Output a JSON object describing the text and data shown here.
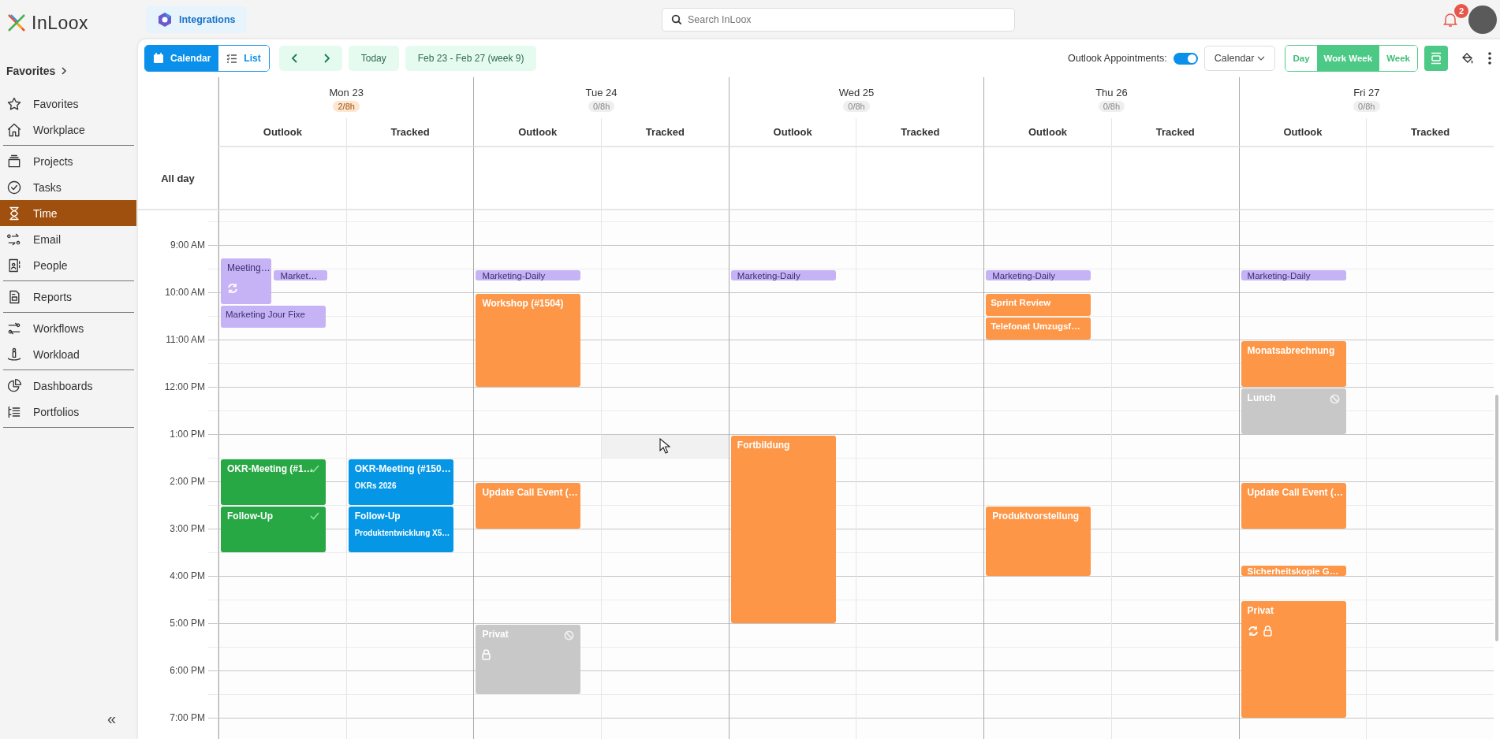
{
  "logo": {
    "text": "InLoox"
  },
  "integrations": {
    "label": "Integrations"
  },
  "search": {
    "placeholder": "Search InLoox"
  },
  "notifications": {
    "count": "2"
  },
  "sidebar": {
    "favorites_header": "Favorites",
    "groups": [
      {
        "items": [
          {
            "label": "Favorites",
            "selected": false
          },
          {
            "label": "Workplace",
            "selected": false
          }
        ]
      },
      {
        "items": [
          {
            "label": "Projects",
            "selected": false
          },
          {
            "label": "Tasks",
            "selected": false
          },
          {
            "label": "Time",
            "selected": true
          },
          {
            "label": "Email",
            "selected": false
          },
          {
            "label": "People",
            "selected": false
          }
        ]
      },
      {
        "items": [
          {
            "label": "Reports",
            "selected": false
          }
        ]
      },
      {
        "items": [
          {
            "label": "Workflows",
            "selected": false
          },
          {
            "label": "Workload",
            "selected": false
          }
        ]
      },
      {
        "items": [
          {
            "label": "Dashboards",
            "selected": false
          },
          {
            "label": "Portfolios",
            "selected": false
          }
        ]
      }
    ],
    "collapse": "«"
  },
  "toolbar": {
    "views": [
      {
        "label": "Calendar",
        "selected": true
      },
      {
        "label": "List",
        "selected": false
      }
    ],
    "today": "Today",
    "range": "Feb 23 - Feb 27 (week 9)",
    "outlook_label": "Outlook Appointments:",
    "outlook_on": true,
    "calendar_select": "Calendar",
    "spans": [
      {
        "label": "Day",
        "selected": false
      },
      {
        "label": "Work Week",
        "selected": true
      },
      {
        "label": "Week",
        "selected": false
      }
    ]
  },
  "all_day_label": "All day",
  "time_labels": [
    "9:00 AM",
    "10:00 AM",
    "11:00 AM",
    "12:00 PM",
    "1:00 PM",
    "2:00 PM",
    "3:00 PM",
    "4:00 PM",
    "5:00 PM",
    "6:00 PM",
    "7:00 PM"
  ],
  "days": [
    {
      "name": "Mon 23",
      "hours": {
        "text": "2/8h",
        "logged": true
      },
      "columns": [
        {
          "label": "Outlook",
          "events": [
            {
              "title": "Meeting…",
              "color": "#c6b3f6",
              "recurring": true,
              "private": false,
              "done": false,
              "declined": false
            },
            {
              "title": "Market…",
              "color": "#c6b3f6",
              "recurring": false,
              "private": false,
              "done": false,
              "declined": false
            },
            {
              "title": "Marketing Jour Fixe",
              "color": "#c6b3f6",
              "recurring": false,
              "private": false,
              "done": false,
              "declined": false
            },
            {
              "title": "OKR-Meeting (#1…",
              "color": "#28a745",
              "recurring": false,
              "private": false,
              "done": true,
              "declined": false
            },
            {
              "title": "Follow-Up",
              "color": "#28a745",
              "recurring": false,
              "private": false,
              "done": true,
              "declined": false
            }
          ]
        },
        {
          "label": "Tracked",
          "events": [
            {
              "title": "OKR-Meeting (#150…",
              "subtitle": "OKRs 2026",
              "color": "#0596e6",
              "recurring": false,
              "private": false,
              "done": false,
              "declined": false
            },
            {
              "title": "Follow-Up",
              "subtitle": "Produktentwicklung X5…",
              "color": "#0596e6",
              "recurring": false,
              "private": false,
              "done": false,
              "declined": false
            }
          ]
        }
      ]
    },
    {
      "name": "Tue 24",
      "hours": {
        "text": "0/8h",
        "logged": false
      },
      "columns": [
        {
          "label": "Outlook",
          "events": [
            {
              "title": "Marketing-Daily",
              "color": "#c6b3f6",
              "recurring": false,
              "private": false,
              "done": false,
              "declined": false
            },
            {
              "title": "Workshop (#1504)",
              "color": "#fd9647",
              "recurring": false,
              "private": false,
              "done": false,
              "declined": false
            },
            {
              "title": "Update Call Event (…",
              "color": "#fd9647",
              "recurring": false,
              "private": false,
              "done": false,
              "declined": false
            },
            {
              "title": "Privat",
              "color": "#c8c8c8",
              "recurring": false,
              "private": true,
              "done": false,
              "declined": true
            }
          ]
        },
        {
          "label": "Tracked",
          "hovered": true
        }
      ]
    },
    {
      "name": "Wed 25",
      "hours": {
        "text": "0/8h",
        "logged": false
      },
      "columns": [
        {
          "label": "Outlook",
          "events": [
            {
              "title": "Marketing-Daily",
              "color": "#c6b3f6",
              "recurring": false,
              "private": false,
              "done": false,
              "declined": false
            },
            {
              "title": "Fortbildung",
              "color": "#fd9647",
              "recurring": false,
              "private": false,
              "done": false,
              "declined": false
            }
          ]
        },
        {
          "label": "Tracked"
        }
      ]
    },
    {
      "name": "Thu 26",
      "hours": {
        "text": "0/8h",
        "logged": false
      },
      "columns": [
        {
          "label": "Outlook",
          "events": [
            {
              "title": "Marketing-Daily",
              "color": "#c6b3f6",
              "recurring": false,
              "private": false,
              "done": false,
              "declined": false
            },
            {
              "title": "Sprint Review",
              "color": "#fd9647",
              "recurring": false,
              "private": false,
              "done": false,
              "declined": false
            },
            {
              "title": "Telefonat Umzugsf…",
              "color": "#fd9647",
              "recurring": false,
              "private": false,
              "done": false,
              "declined": false
            },
            {
              "title": "Produktvorstellung",
              "color": "#fd9647",
              "recurring": false,
              "private": false,
              "done": false,
              "declined": false
            }
          ]
        },
        {
          "label": "Tracked"
        }
      ]
    },
    {
      "name": "Fri 27",
      "hours": {
        "text": "0/8h",
        "logged": false
      },
      "columns": [
        {
          "label": "Outlook",
          "events": [
            {
              "title": "Marketing-Daily",
              "color": "#c6b3f6",
              "recurring": false,
              "private": false,
              "done": false,
              "declined": false
            },
            {
              "title": "Monatsabrechnung",
              "color": "#fd9647",
              "recurring": false,
              "private": false,
              "done": false,
              "declined": false
            },
            {
              "title": "Lunch",
              "color": "#c8c8c8",
              "recurring": false,
              "private": false,
              "done": false,
              "declined": true
            },
            {
              "title": "Update Call Event (…",
              "color": "#fd9647",
              "recurring": false,
              "private": false,
              "done": false,
              "declined": false
            },
            {
              "title": "Sicherheitskopie G…",
              "color": "#fd9647",
              "recurring": false,
              "private": false,
              "done": false,
              "declined": false
            },
            {
              "title": "Privat",
              "color": "#fd9647",
              "recurring": true,
              "private": true,
              "done": false,
              "declined": false
            }
          ]
        },
        {
          "label": "Tracked"
        }
      ]
    }
  ]
}
